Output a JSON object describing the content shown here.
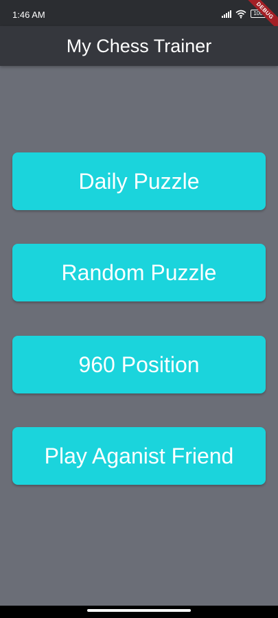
{
  "status_bar": {
    "time": "1:46 AM",
    "battery": "100",
    "icons": [
      "signal-icon",
      "wifi-icon",
      "battery-icon"
    ]
  },
  "debug_banner": "DEBUG",
  "app_bar": {
    "title": "My Chess Trainer"
  },
  "menu": {
    "buttons": [
      {
        "label": "Daily Puzzle"
      },
      {
        "label": "Random Puzzle"
      },
      {
        "label": "960 Position"
      },
      {
        "label": "Play Aganist Friend"
      }
    ]
  },
  "colors": {
    "background": "#6b6e77",
    "app_bar": "#35373d",
    "status_bar": "#2b2d31",
    "button": "#1bd4dc",
    "button_text": "#ffffff"
  }
}
